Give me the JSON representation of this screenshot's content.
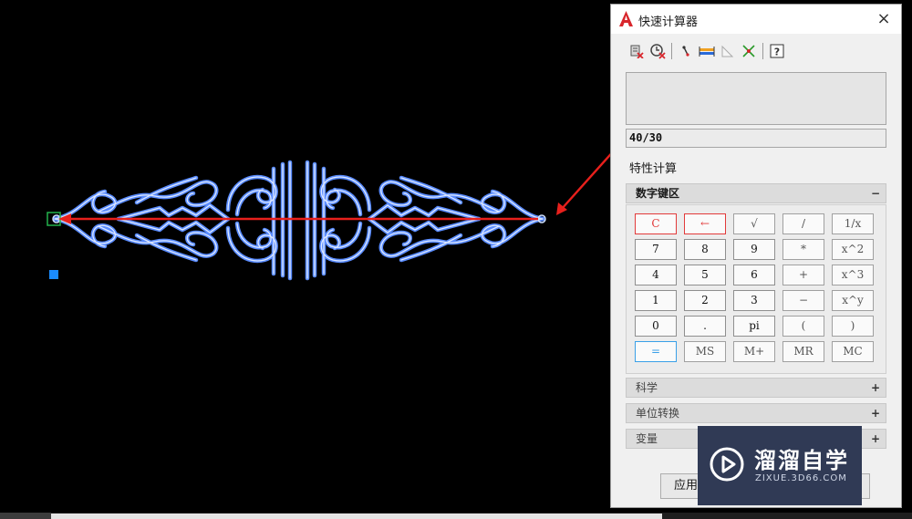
{
  "window": {
    "title": "快速计算器",
    "close_glyph": "×",
    "icon": "autocad-a-icon"
  },
  "toolbar": {
    "buttons": [
      {
        "icon": "clear-icon"
      },
      {
        "icon": "clear-history-icon"
      },
      {
        "icon": "get-coordinates-icon"
      },
      {
        "icon": "distance-between-two-points-icon"
      },
      {
        "icon": "angle-of-line-icon"
      },
      {
        "icon": "intersection-icon"
      },
      {
        "icon": "help-icon"
      }
    ]
  },
  "input": {
    "value": "40/30"
  },
  "property_calc": {
    "label": "特性计算"
  },
  "sections": {
    "numeric_keypad": {
      "label": "数字键区",
      "toggle": "−"
    },
    "scientific": {
      "label": "科学",
      "toggle": "+"
    },
    "unit_conversion": {
      "label": "单位转换",
      "toggle": "+"
    },
    "variables": {
      "label": "变量",
      "toggle": "+"
    }
  },
  "keypad": {
    "rows": [
      [
        "C",
        "←",
        "√",
        "/",
        "1/x"
      ],
      [
        "7",
        "8",
        "9",
        "*",
        "x^2"
      ],
      [
        "4",
        "5",
        "6",
        "+",
        "x^3"
      ],
      [
        "1",
        "2",
        "3",
        "−",
        "x^y"
      ],
      [
        "0",
        ".",
        "pi",
        "(",
        ")"
      ],
      [
        "=",
        "MS",
        "M+",
        "MR",
        "MC"
      ]
    ]
  },
  "buttons": {
    "apply": "应用"
  },
  "watermark": {
    "title": "溜溜自学",
    "subtitle": "ZIXUE.3D66.COM"
  },
  "colors": {
    "cad_background": "#000000",
    "ornament_outer": "#5a8cff",
    "ornament_inner": "#cfe0ff",
    "arrow": "#e8201c",
    "selection_marker": "#1a8cff",
    "key_red": "#e23a3a",
    "key_blue": "#3aa0e8"
  }
}
